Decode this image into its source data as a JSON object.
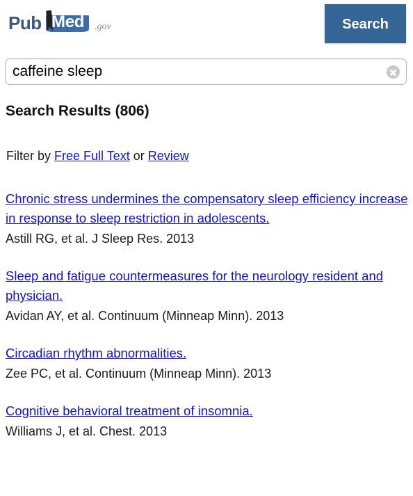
{
  "header": {
    "logo": {
      "part1": "Pub",
      "part2": "Med",
      "suffix": ".gov",
      "icon": "open-book-icon"
    },
    "search_button_label": "Search",
    "accent_color": "#356595"
  },
  "search": {
    "value": "caffeine sleep",
    "placeholder": "Search PubMed",
    "clear_icon": "clear-circle-x-icon"
  },
  "results": {
    "heading": "Search Results (806)",
    "count": 806,
    "filter": {
      "prefix": "Filter by",
      "link1": "Free Full Text",
      "conjunction": "or",
      "link2": "Review",
      "link_color": "#1414c8"
    },
    "items": [
      {
        "title": "Chronic stress undermines the compensatory sleep efficiency increase in response to sleep restriction in adolescents.",
        "meta": "Astill RG, et al. J Sleep Res. 2013"
      },
      {
        "title": "Sleep and fatigue countermeasures for the neurology resident and physician.",
        "meta": "Avidan AY, et al. Continuum (Minneap Minn). 2013"
      },
      {
        "title": "Circadian rhythm abnormalities.",
        "meta": "Zee PC, et al. Continuum (Minneap Minn). 2013"
      },
      {
        "title": "Cognitive behavioral treatment of insomnia.",
        "meta": "Williams J, et al. Chest. 2013"
      }
    ]
  }
}
